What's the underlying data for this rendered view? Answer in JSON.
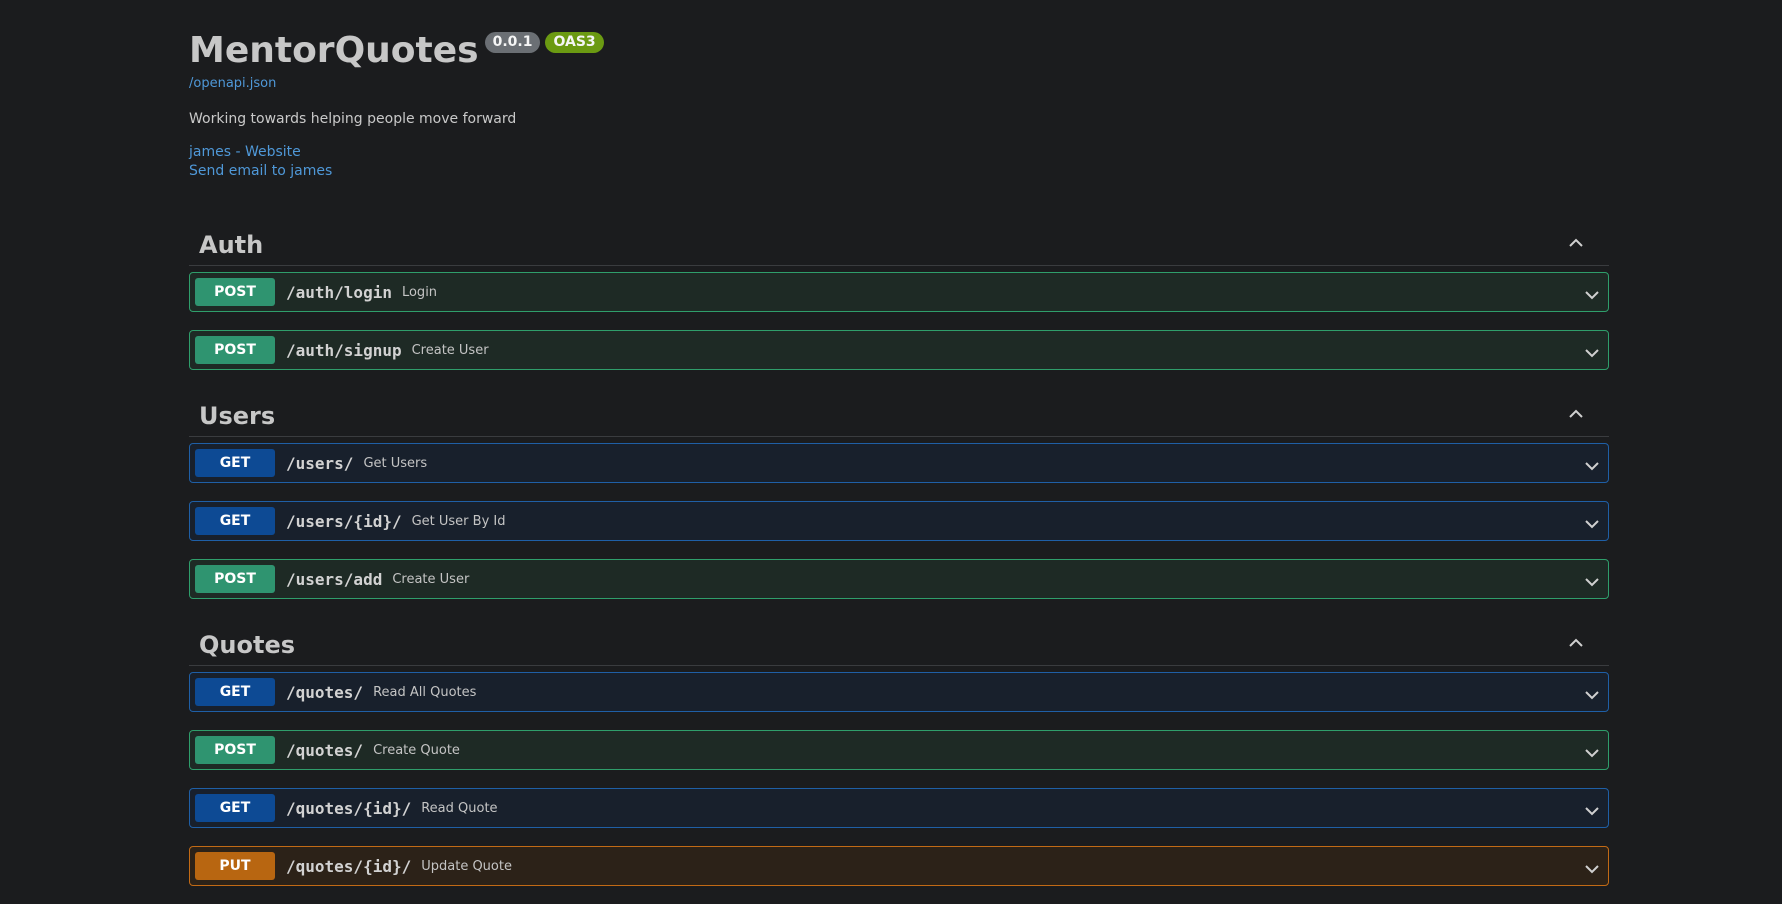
{
  "info": {
    "title": "MentorQuotes",
    "version": "0.0.1",
    "oas": "OAS3",
    "spec_url": "/openapi.json",
    "description": "Working towards helping people move forward",
    "contact_website": "james - Website",
    "contact_email": "Send email to james"
  },
  "sections": [
    {
      "name": "Auth",
      "ops": [
        {
          "method": "POST",
          "path": "/auth/login",
          "summary": "Login"
        },
        {
          "method": "POST",
          "path": "/auth/signup",
          "summary": "Create User"
        }
      ]
    },
    {
      "name": "Users",
      "ops": [
        {
          "method": "GET",
          "path": "/users/",
          "summary": "Get Users"
        },
        {
          "method": "GET",
          "path": "/users/{id}/",
          "summary": "Get User By Id"
        },
        {
          "method": "POST",
          "path": "/users/add",
          "summary": "Create User"
        }
      ]
    },
    {
      "name": "Quotes",
      "ops": [
        {
          "method": "GET",
          "path": "/quotes/",
          "summary": "Read All Quotes"
        },
        {
          "method": "POST",
          "path": "/quotes/",
          "summary": "Create Quote"
        },
        {
          "method": "GET",
          "path": "/quotes/{id}/",
          "summary": "Read Quote"
        },
        {
          "method": "PUT",
          "path": "/quotes/{id}/",
          "summary": "Update Quote"
        }
      ]
    }
  ],
  "colors": {
    "post": "#2f9470",
    "get": "#0d4a94",
    "put": "#b86611",
    "link": "#4f98d8"
  },
  "icons": {
    "section_toggle": "chevron-up-icon",
    "operation_toggle": "chevron-down-icon"
  }
}
